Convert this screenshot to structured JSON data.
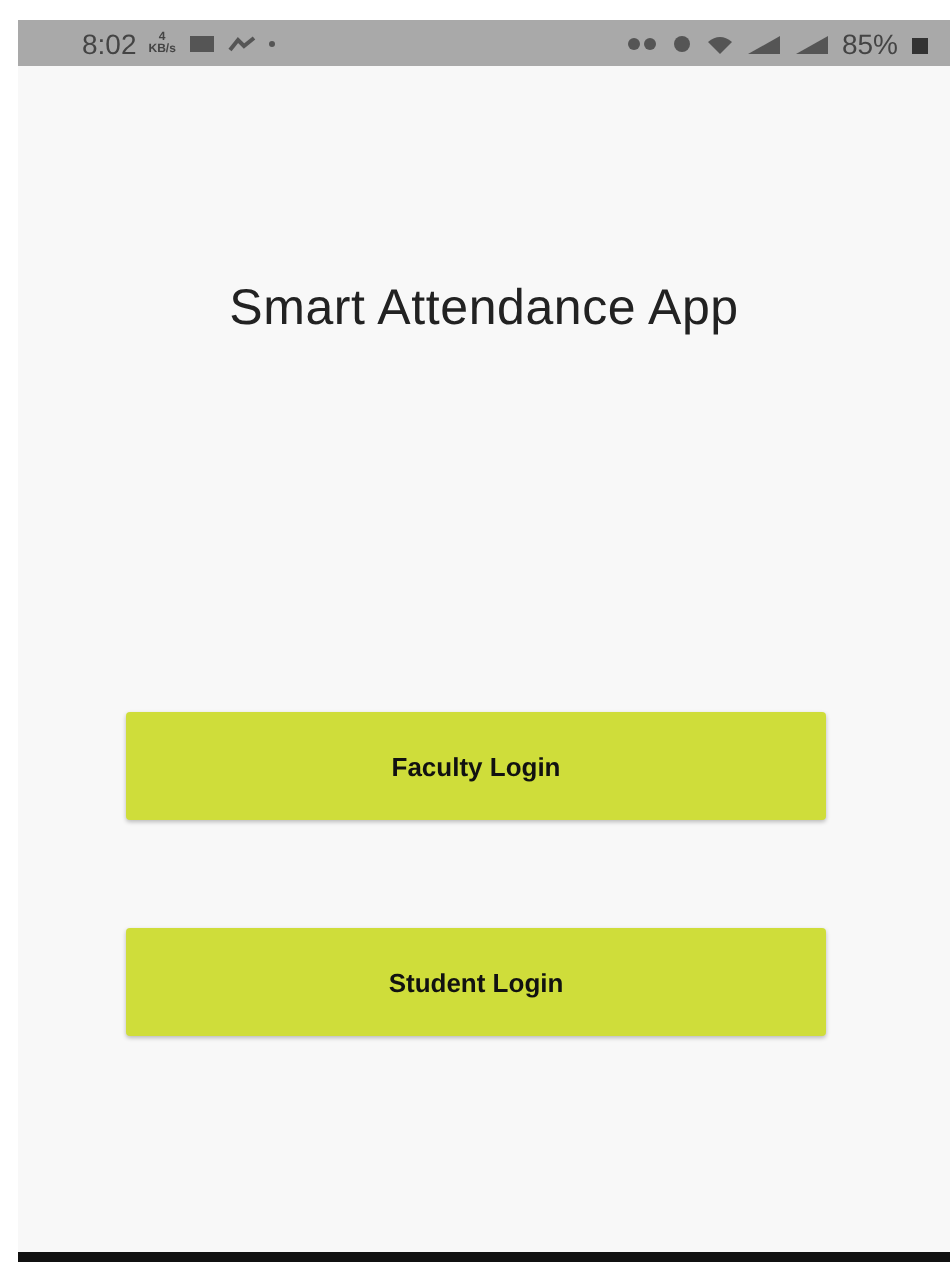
{
  "status_bar": {
    "time": "8:02",
    "net_speed_value": "4",
    "net_speed_unit": "KB/s",
    "battery": "85%"
  },
  "title": "Smart Attendance App",
  "buttons": [
    {
      "label": "Faculty Login"
    },
    {
      "label": "Student Login"
    }
  ]
}
